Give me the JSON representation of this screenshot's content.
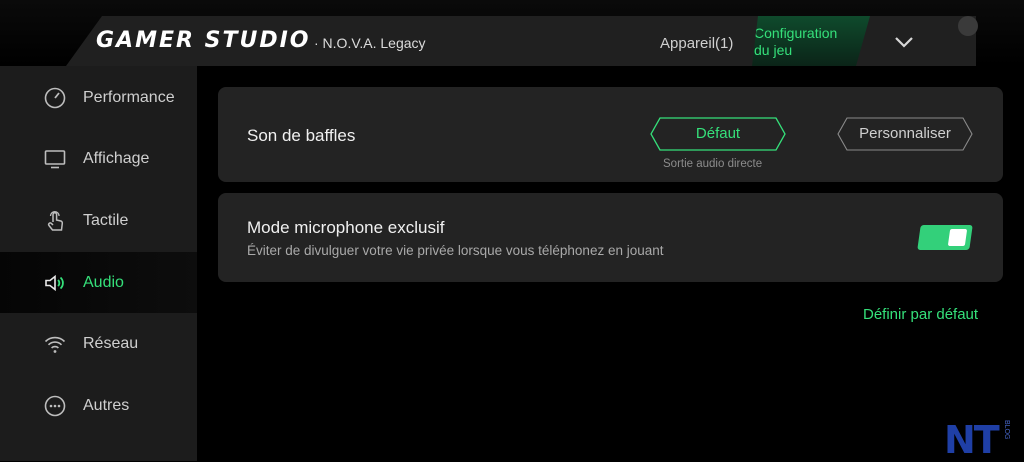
{
  "header": {
    "brand": "GAMER STUDIO",
    "game": "· N.O.V.A. Legacy",
    "tab_device": "Appareil(1)",
    "tab_config_line1": "Configuration",
    "tab_config_line2": "du jeu",
    "chevron_icon": "chevron-down-icon"
  },
  "sidebar": {
    "items": [
      {
        "label": "Performance",
        "icon": "speedometer-icon"
      },
      {
        "label": "Affichage",
        "icon": "monitor-icon"
      },
      {
        "label": "Tactile",
        "icon": "touch-icon"
      },
      {
        "label": "Audio",
        "icon": "speaker-icon",
        "active": true
      },
      {
        "label": "Réseau",
        "icon": "wifi-icon"
      },
      {
        "label": "Autres",
        "icon": "more-icon"
      }
    ]
  },
  "main": {
    "speaker": {
      "title": "Son de baffles",
      "option_default": "Défaut",
      "option_custom": "Personnaliser",
      "hint": "Sortie audio directe"
    },
    "mic": {
      "title": "Mode microphone exclusif",
      "subtitle": "Éviter de divulguer votre vie privée lorsque vous téléphonez en jouant",
      "enabled": true
    },
    "reset_label": "Définir par défaut"
  },
  "watermark": {
    "text": "NT",
    "small": "BLOG"
  },
  "colors": {
    "accent": "#35e07a",
    "card": "#232323",
    "sidebar": "#1c1c1c"
  }
}
